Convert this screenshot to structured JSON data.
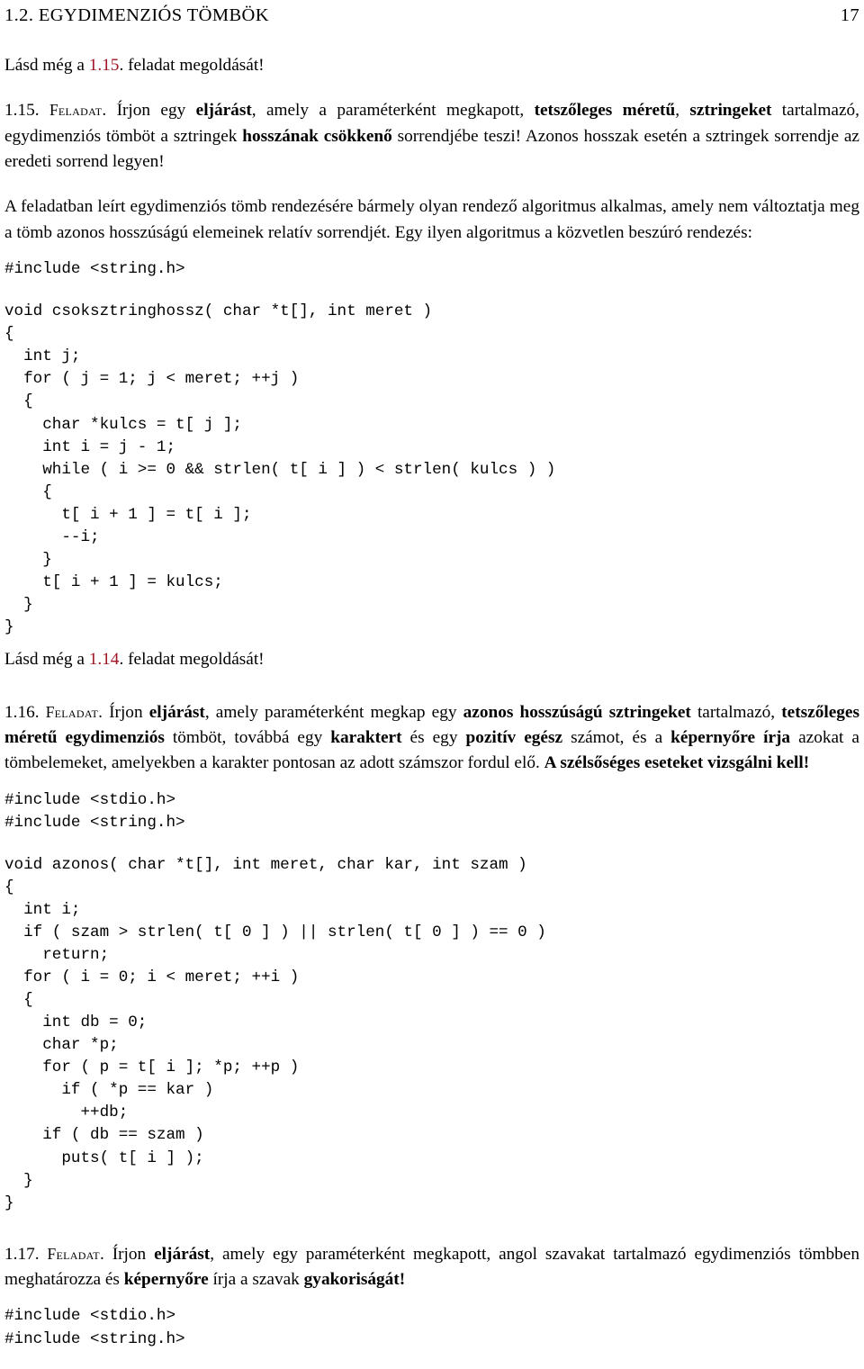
{
  "running_head": {
    "section_title": "1.2. EGYDIMENZIÓS TÖMBÖK",
    "page_number": "17"
  },
  "see_also_1": {
    "prefix": "Lásd még a ",
    "xref": "1.15",
    "suffix": ". feladat megoldását!"
  },
  "exercise_1_15": {
    "number": "1.15.",
    "label": "Feladat",
    "period": ".",
    "text_1": " Írjon egy ",
    "bold_1": "eljárást",
    "text_2": ", amely a paraméterként megkapott, ",
    "bold_2": "tetszőleges méretű",
    "text_3": ", ",
    "bold_3": "sztringeket",
    "text_4": " tartalmazó, egydimenziós tömböt a sztringek ",
    "bold_4": "hosszának csökkenő",
    "text_5": " sorrendjébe teszi! Azonos hosszak esetén a sztringek sorrendje az eredeti sorrend legyen!"
  },
  "paragraph_algorithm": {
    "text": "A feladatban leírt egydimenziós tömb rendezésére bármely olyan rendező algoritmus alkalmas, amely nem változtatja meg a tömb azonos hosszúságú elemeinek relatív sorrendjét. Egy ilyen algoritmus a közvetlen beszúró rendezés:"
  },
  "code_block_1": {
    "include": "#include <string.h>",
    "body": "void csoksztringhossz( char *t[], int meret )\n{\n  int j;\n  for ( j = 1; j < meret; ++j )\n  {\n    char *kulcs = t[ j ];\n    int i = j - 1;\n    while ( i >= 0 && strlen( t[ i ] ) < strlen( kulcs ) )\n    {\n      t[ i + 1 ] = t[ i ];\n      --i;\n    }\n    t[ i + 1 ] = kulcs;\n  }\n}"
  },
  "see_also_2": {
    "prefix": "Lásd még a ",
    "xref": "1.14",
    "suffix": ". feladat megoldását!"
  },
  "exercise_1_16": {
    "number": "1.16.",
    "label": "Feladat",
    "period": ".",
    "text_1": " Írjon ",
    "bold_1": "eljárást",
    "text_2": ", amely paraméterként megkap egy ",
    "bold_2": "azonos hosszúságú sztringeket",
    "text_3": " tartalmazó, ",
    "bold_3": "tetszőleges méretű egydimenziós",
    "text_4": " tömböt, továbbá egy ",
    "bold_4": "karaktert",
    "text_5": " és egy ",
    "bold_5": "pozitív egész",
    "text_6": " számot, és a ",
    "bold_6": "képernyőre írja",
    "text_7": " azokat a tömbelemeket, amelyekben a karakter pontosan az adott számszor fordul elő. ",
    "bold_7": "A szélsőséges eseteket vizsgálni kell!"
  },
  "code_block_2": {
    "includes": "#include <stdio.h>\n#include <string.h>",
    "body": "void azonos( char *t[], int meret, char kar, int szam )\n{\n  int i;\n  if ( szam > strlen( t[ 0 ] ) || strlen( t[ 0 ] ) == 0 )\n    return;\n  for ( i = 0; i < meret; ++i )\n  {\n    int db = 0;\n    char *p;\n    for ( p = t[ i ]; *p; ++p )\n      if ( *p == kar )\n        ++db;\n    if ( db == szam )\n      puts( t[ i ] );\n  }\n}"
  },
  "exercise_1_17": {
    "number": "1.17.",
    "label": "Feladat",
    "period": ".",
    "text_1": " Írjon ",
    "bold_1": "eljárást",
    "text_2": ", amely egy paraméterként megkapott, angol szavakat tartalmazó egydimenziós tömbben meghatározza és ",
    "bold_2": "képernyőre",
    "text_3": " írja a szavak ",
    "bold_3": "gyakoriságát!"
  },
  "code_block_3": {
    "includes": "#include <stdio.h>\n#include <string.h>"
  },
  "colors": {
    "xref_red": "#a01423",
    "text_black": "#000000",
    "page_background": "#ffffff"
  }
}
